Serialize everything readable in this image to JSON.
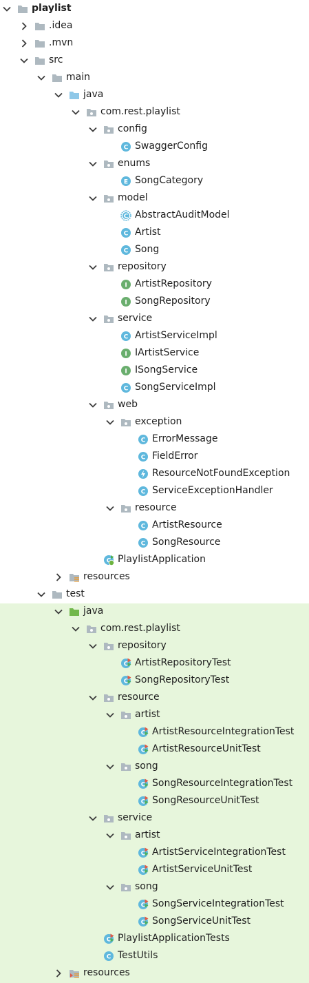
{
  "tree": [
    {
      "label": "playlist",
      "depth": 0,
      "kind": "module",
      "expanded": true,
      "bold": true
    },
    {
      "label": ".idea",
      "depth": 1,
      "kind": "folder",
      "expanded": false
    },
    {
      "label": ".mvn",
      "depth": 1,
      "kind": "folder",
      "expanded": false
    },
    {
      "label": "src",
      "depth": 1,
      "kind": "folder",
      "expanded": true
    },
    {
      "label": "main",
      "depth": 2,
      "kind": "folder",
      "expanded": true
    },
    {
      "label": "java",
      "depth": 3,
      "kind": "source-root",
      "expanded": true
    },
    {
      "label": "com.rest.playlist",
      "depth": 4,
      "kind": "package",
      "expanded": true
    },
    {
      "label": "config",
      "depth": 5,
      "kind": "package",
      "expanded": true
    },
    {
      "label": "SwaggerConfig",
      "depth": 6,
      "kind": "class"
    },
    {
      "label": "enums",
      "depth": 5,
      "kind": "package",
      "expanded": true
    },
    {
      "label": "SongCategory",
      "depth": 6,
      "kind": "enum"
    },
    {
      "label": "model",
      "depth": 5,
      "kind": "package",
      "expanded": true
    },
    {
      "label": "AbstractAuditModel",
      "depth": 6,
      "kind": "abstract-class"
    },
    {
      "label": "Artist",
      "depth": 6,
      "kind": "class"
    },
    {
      "label": "Song",
      "depth": 6,
      "kind": "class"
    },
    {
      "label": "repository",
      "depth": 5,
      "kind": "package",
      "expanded": true
    },
    {
      "label": "ArtistRepository",
      "depth": 6,
      "kind": "interface"
    },
    {
      "label": "SongRepository",
      "depth": 6,
      "kind": "interface"
    },
    {
      "label": "service",
      "depth": 5,
      "kind": "package",
      "expanded": true
    },
    {
      "label": "ArtistServiceImpl",
      "depth": 6,
      "kind": "class"
    },
    {
      "label": "IArtistService",
      "depth": 6,
      "kind": "interface"
    },
    {
      "label": "ISongService",
      "depth": 6,
      "kind": "interface"
    },
    {
      "label": "SongServiceImpl",
      "depth": 6,
      "kind": "class"
    },
    {
      "label": "web",
      "depth": 5,
      "kind": "package",
      "expanded": true
    },
    {
      "label": "exception",
      "depth": 6,
      "kind": "package",
      "expanded": true
    },
    {
      "label": "ErrorMessage",
      "depth": 7,
      "kind": "class"
    },
    {
      "label": "FieldError",
      "depth": 7,
      "kind": "class"
    },
    {
      "label": "ResourceNotFoundException",
      "depth": 7,
      "kind": "exception"
    },
    {
      "label": "ServiceExceptionHandler",
      "depth": 7,
      "kind": "class"
    },
    {
      "label": "resource",
      "depth": 6,
      "kind": "package",
      "expanded": true
    },
    {
      "label": "ArtistResource",
      "depth": 7,
      "kind": "class"
    },
    {
      "label": "SongResource",
      "depth": 7,
      "kind": "class"
    },
    {
      "label": "PlaylistApplication",
      "depth": 5,
      "kind": "spring-app"
    },
    {
      "label": "resources",
      "depth": 3,
      "kind": "resources",
      "expanded": false
    },
    {
      "label": "test",
      "depth": 2,
      "kind": "folder",
      "expanded": true
    },
    {
      "label": "java",
      "depth": 3,
      "kind": "test-root",
      "expanded": true
    },
    {
      "label": "com.rest.playlist",
      "depth": 4,
      "kind": "package",
      "expanded": true
    },
    {
      "label": "repository",
      "depth": 5,
      "kind": "package",
      "expanded": true
    },
    {
      "label": "ArtistRepositoryTest",
      "depth": 6,
      "kind": "test-class"
    },
    {
      "label": "SongRepositoryTest",
      "depth": 6,
      "kind": "test-class"
    },
    {
      "label": "resource",
      "depth": 5,
      "kind": "package",
      "expanded": true
    },
    {
      "label": "artist",
      "depth": 6,
      "kind": "package",
      "expanded": true
    },
    {
      "label": "ArtistResourceIntegrationTest",
      "depth": 7,
      "kind": "test-class"
    },
    {
      "label": "ArtistResourceUnitTest",
      "depth": 7,
      "kind": "test-class"
    },
    {
      "label": "song",
      "depth": 6,
      "kind": "package",
      "expanded": true
    },
    {
      "label": "SongResourceIntegrationTest",
      "depth": 7,
      "kind": "test-class"
    },
    {
      "label": "SongResourceUnitTest",
      "depth": 7,
      "kind": "test-class"
    },
    {
      "label": "service",
      "depth": 5,
      "kind": "package",
      "expanded": true
    },
    {
      "label": "artist",
      "depth": 6,
      "kind": "package",
      "expanded": true
    },
    {
      "label": "ArtistServiceIntegrationTest",
      "depth": 7,
      "kind": "test-class"
    },
    {
      "label": "ArtistServiceUnitTest",
      "depth": 7,
      "kind": "test-class"
    },
    {
      "label": "song",
      "depth": 6,
      "kind": "package",
      "expanded": true
    },
    {
      "label": "SongServiceIntegrationTest",
      "depth": 7,
      "kind": "test-class"
    },
    {
      "label": "SongServiceUnitTest",
      "depth": 7,
      "kind": "test-class"
    },
    {
      "label": "PlaylistApplicationTests",
      "depth": 5,
      "kind": "test-class"
    },
    {
      "label": "TestUtils",
      "depth": 5,
      "kind": "class"
    },
    {
      "label": "resources",
      "depth": 3,
      "kind": "test-resources",
      "expanded": false
    }
  ],
  "colors": {
    "test_background": "#e7f6dc",
    "folder": "#aeb9c0",
    "source_root": "#8fc8e8",
    "test_root": "#72b84c",
    "class": "#5fb8dd",
    "interface": "#6aae6e",
    "test_marker_red": "#e05a45",
    "test_marker_green": "#4caf50"
  }
}
